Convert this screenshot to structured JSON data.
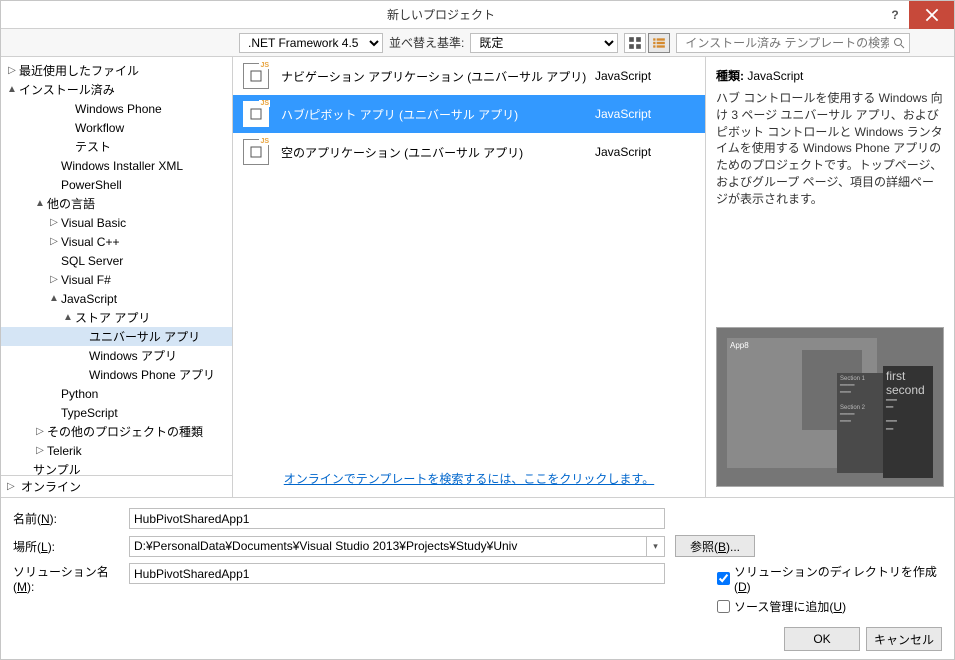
{
  "dialog": {
    "title": "新しいプロジェクト"
  },
  "toolbar": {
    "framework": ".NET Framework 4.5",
    "sort_label": "並べ替え基準:",
    "sort_value": "既定",
    "search_placeholder": "インストール済み テンプレートの検索 (Ctrl"
  },
  "tree": {
    "recent": "最近使用したファイル",
    "installed": "インストール済み",
    "nodes": [
      {
        "label": "Windows Phone",
        "indent": 3,
        "caret": ""
      },
      {
        "label": "Workflow",
        "indent": 3,
        "caret": ""
      },
      {
        "label": "テスト",
        "indent": 3,
        "caret": ""
      },
      {
        "label": "Windows Installer XML",
        "indent": 2,
        "caret": ""
      },
      {
        "label": "PowerShell",
        "indent": 2,
        "caret": ""
      },
      {
        "label": "他の言語",
        "indent": 1,
        "caret": "▲"
      },
      {
        "label": "Visual Basic",
        "indent": 2,
        "caret": "▷"
      },
      {
        "label": "Visual C++",
        "indent": 2,
        "caret": "▷"
      },
      {
        "label": "SQL Server",
        "indent": 2,
        "caret": ""
      },
      {
        "label": "Visual F#",
        "indent": 2,
        "caret": "▷"
      },
      {
        "label": "JavaScript",
        "indent": 2,
        "caret": "▲"
      },
      {
        "label": "ストア アプリ",
        "indent": 3,
        "caret": "▲"
      },
      {
        "label": "ユニバーサル アプリ",
        "indent": 4,
        "caret": "",
        "selected": true
      },
      {
        "label": "Windows アプリ",
        "indent": 4,
        "caret": ""
      },
      {
        "label": "Windows Phone アプリ",
        "indent": 4,
        "caret": ""
      },
      {
        "label": "Python",
        "indent": 2,
        "caret": ""
      },
      {
        "label": "TypeScript",
        "indent": 2,
        "caret": ""
      },
      {
        "label": "その他のプロジェクトの種類",
        "indent": 1,
        "caret": "▷"
      },
      {
        "label": "Telerik",
        "indent": 1,
        "caret": "▷"
      },
      {
        "label": "サンプル",
        "indent": 0,
        "caret": ""
      }
    ],
    "online": "オンライン"
  },
  "templates": [
    {
      "name": "ナビゲーション アプリケーション (ユニバーサル アプリ)",
      "lang": "JavaScript",
      "selected": false
    },
    {
      "name": "ハブ/ピボット アプリ (ユニバーサル アプリ)",
      "lang": "JavaScript",
      "selected": true
    },
    {
      "name": "空のアプリケーション (ユニバーサル アプリ)",
      "lang": "JavaScript",
      "selected": false
    }
  ],
  "center_link": "オンラインでテンプレートを検索するには、ここをクリックします。",
  "right": {
    "kind_label": "種類:",
    "kind_value": "JavaScript",
    "description": "ハブ コントロールを使用する Windows 向け 3 ページ ユニバーサル アプリ、およびピボット コントロールと Windows ランタイムを使用する Windows Phone アプリのためのプロジェクトです。トップページ、およびグループ ページ、項目の詳細ページが表示されます。",
    "preview_app": "App8",
    "preview_words": "first second"
  },
  "form": {
    "name_label": "名前(N):",
    "name_mnemonic": "N",
    "name_value": "HubPivotSharedApp1",
    "location_label": "場所(L):",
    "location_mnemonic": "L",
    "location_value": "D:¥PersonalData¥Documents¥Visual Studio 2013¥Projects¥Study¥Univ",
    "browse": "参照(B)...",
    "browse_mnemonic": "B",
    "solution_label": "ソリューション名(M):",
    "solution_mnemonic": "M",
    "solution_value": "HubPivotSharedApp1",
    "chk_dir": "ソリューションのディレクトリを作成(D)",
    "chk_dir_checked": true,
    "chk_src": "ソース管理に追加(U)",
    "chk_src_checked": false
  },
  "buttons": {
    "ok": "OK",
    "cancel": "キャンセル"
  }
}
